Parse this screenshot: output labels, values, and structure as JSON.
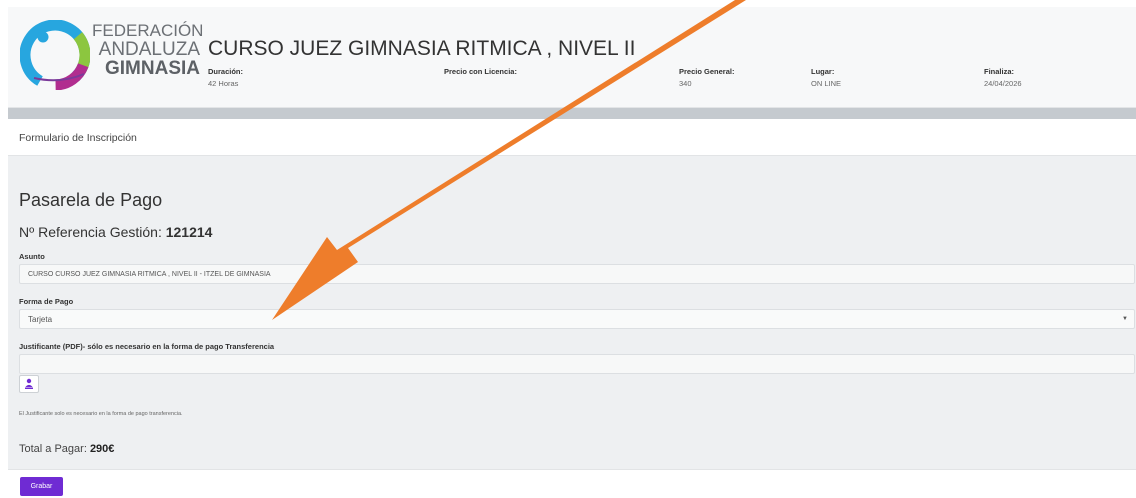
{
  "logo": {
    "line1": "FEDERACIÓN",
    "line2": "ANDALUZA",
    "line3": "GIMNASIA"
  },
  "course": {
    "title": "CURSO JUEZ GIMNASIA RITMICA , NIVEL II",
    "meta": [
      {
        "key": "Duración:",
        "value": "42 Horas"
      },
      {
        "key": "Precio con Licencia:",
        "value": ""
      },
      {
        "key": "Precio General:",
        "value": "340"
      },
      {
        "key": "Lugar:",
        "value": "ON LINE"
      },
      {
        "key": "Finaliza:",
        "value": "24/04/2026"
      }
    ]
  },
  "form": {
    "section_title": "Formulario de Inscripción",
    "heading": "Pasarela de Pago",
    "reference_label": "Nº Referencia Gestión:",
    "reference_value": "121214",
    "subject_label": "Asunto",
    "subject_value": "CURSO CURSO JUEZ GIMNASIA RITMICA , NIVEL II - ITZEL DE GIMNASIA",
    "payment_label": "Forma de Pago",
    "payment_value": "Tarjeta",
    "receipt_label": "Justificante (PDF)- sólo es necesario en la forma de pago Transferencia",
    "receipt_value": "",
    "note": "El Justificante solo es necesario en la forma de pago transferencia.",
    "total_label": "Total a Pagar:",
    "total_value": "290€",
    "save_label": "Grabar"
  },
  "icons": {
    "upload": "upload-icon",
    "dropdown": "chevron-down-icon",
    "annotation": "arrow-annotation"
  },
  "colors": {
    "accent": "#6f2bd3",
    "arrow": "#ee7d2b"
  }
}
